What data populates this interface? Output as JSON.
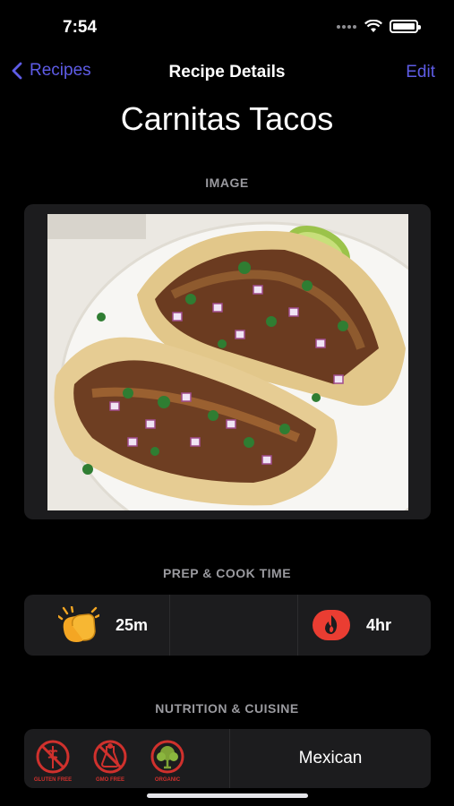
{
  "status_bar": {
    "time": "7:54"
  },
  "nav": {
    "back_label": "Recipes",
    "title": "Recipe Details",
    "edit_label": "Edit"
  },
  "recipe": {
    "name": "Carnitas Tacos"
  },
  "sections": {
    "image": "IMAGE",
    "prep_cook": "PREP & COOK TIME",
    "nutrition_cuisine": "NUTRITION & CUISINE"
  },
  "times": {
    "prep": {
      "icon": "clapping-hands-icon",
      "value": "25m"
    },
    "cook": {
      "icon": "fire-icon",
      "value": "4hr"
    }
  },
  "nutrition": {
    "badges": [
      {
        "icon": "gluten-free-icon",
        "label": "GLUTEN FREE"
      },
      {
        "icon": "gmo-free-icon",
        "label": "GMO FREE"
      },
      {
        "icon": "organic-icon",
        "label": "ORGANIC"
      }
    ],
    "cuisine": "Mexican"
  },
  "colors": {
    "accent": "#5e5ce6",
    "card": "#1c1c1e",
    "badge_red": "#d0312d",
    "clap_yellow": "#f4a623",
    "fire_red": "#ea3d32"
  }
}
